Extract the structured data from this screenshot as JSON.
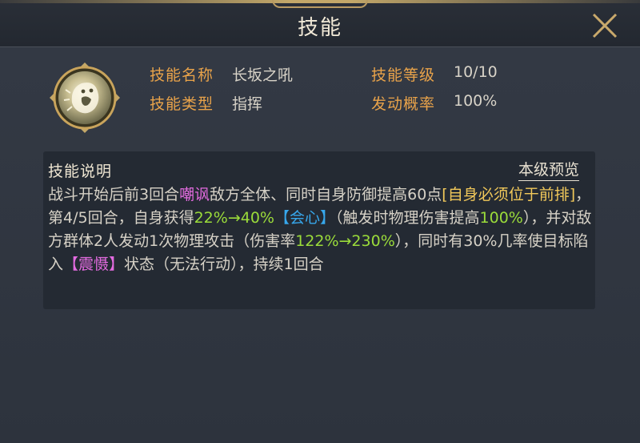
{
  "title": "技能",
  "skill": {
    "name_label": "技能名称",
    "name_value": "长坂之吼",
    "level_label": "技能等级",
    "level_value": "10/10",
    "type_label": "技能类型",
    "type_value": "指挥",
    "chance_label": "发动概率",
    "chance_value": "100%"
  },
  "description": {
    "title": "技能说明",
    "preview_link": "本级预览",
    "segments": [
      {
        "text": "战斗开始后前3回合",
        "style": "normal"
      },
      {
        "text": "嘲讽",
        "style": "pink"
      },
      {
        "text": "敌方全体、同时自身防御提高60点",
        "style": "normal"
      },
      {
        "text": "[自身必须位于前排]",
        "style": "yellow"
      },
      {
        "text": "，第4/5回合，自身获得",
        "style": "normal"
      },
      {
        "text": "22%→40%",
        "style": "green"
      },
      {
        "text": "【会心】",
        "style": "blue"
      },
      {
        "text": "（触发时物理伤害提高",
        "style": "normal"
      },
      {
        "text": "100%",
        "style": "green"
      },
      {
        "text": "），并对敌方群体2人发动1次物理攻击（伤害率",
        "style": "normal"
      },
      {
        "text": "122%→230%",
        "style": "green"
      },
      {
        "text": "），同时有30%几率使目标陷入",
        "style": "normal"
      },
      {
        "text": "【震慑】",
        "style": "pink"
      },
      {
        "text": "状态（无法行动），持续1回合",
        "style": "normal"
      }
    ]
  },
  "colors": {
    "label": "#e9a34a",
    "pink": "#e36be0",
    "yellow": "#f1c85a",
    "green": "#9bdc3a",
    "blue": "#37a7ec"
  },
  "icons": {
    "close": "close-x-icon",
    "skill": "lion-roar-icon"
  }
}
